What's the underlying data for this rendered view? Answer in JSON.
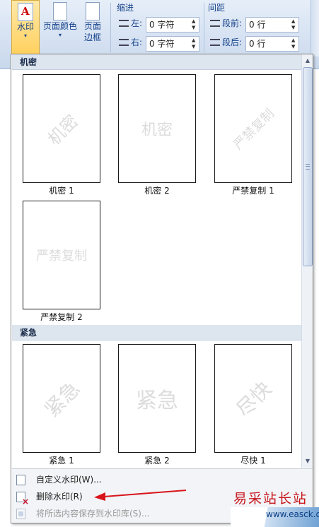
{
  "ribbon": {
    "watermark_label": "水印",
    "page_color_label": "页面颜色",
    "page_border_label_1": "页面",
    "page_border_label_2": "边框",
    "indent_title": "缩进",
    "spacing_title": "间距",
    "indent_left_label": "左:",
    "indent_left_value": "0 字符",
    "indent_right_label": "右:",
    "indent_right_value": "0 字符",
    "spacing_before_label": "段前:",
    "spacing_before_value": "0 行",
    "spacing_after_label": "段后:",
    "spacing_after_value": "0 行"
  },
  "gallery": {
    "sections": [
      {
        "title": "机密",
        "items": [
          {
            "caption": "机密 1",
            "watermark_text": "机密",
            "style": "diagonal"
          },
          {
            "caption": "机密 2",
            "watermark_text": "机密",
            "style": "horizontal"
          },
          {
            "caption": "严禁复制 1",
            "watermark_text": "严禁复制",
            "style": "diagonal"
          },
          {
            "caption": "严禁复制 2",
            "watermark_text": "严禁复制",
            "style": "horizontal"
          }
        ]
      },
      {
        "title": "紧急",
        "items": [
          {
            "caption": "紧急 1",
            "watermark_text": "紧急",
            "style": "diagonal"
          },
          {
            "caption": "紧急 2",
            "watermark_text": "紧急",
            "style": "horizontal"
          },
          {
            "caption": "尽快 1",
            "watermark_text": "尽快",
            "style": "diagonal"
          }
        ]
      }
    ]
  },
  "menu": {
    "custom_watermark": "自定义水印(W)...",
    "remove_watermark": "删除水印(R)",
    "save_selection": "将所选内容保存到水印库(S)..."
  },
  "logo": {
    "text": "易采站长站",
    "url": "www.easck.com"
  },
  "colors": {
    "annotation_arrow": "#d8141a",
    "ribbon_text": "#15428b",
    "watermark_gray": "#dcdcdc"
  }
}
